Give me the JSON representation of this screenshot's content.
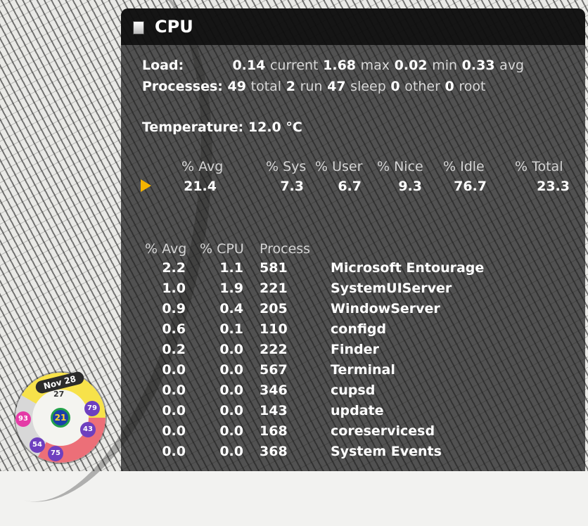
{
  "window": {
    "title": "CPU",
    "load": {
      "label": "Load:",
      "current": "0.14",
      "current_label": "current",
      "max": "1.68",
      "max_label": "max",
      "min": "0.02",
      "min_label": "min",
      "avg": "0.33",
      "avg_label": "avg"
    },
    "processes": {
      "label": "Processes:",
      "total": "49",
      "total_label": "total",
      "run": "2",
      "run_label": "run",
      "sleep": "47",
      "sleep_label": "sleep",
      "other": "0",
      "other_label": "other",
      "root": "0",
      "root_label": "root"
    },
    "temperature": {
      "label": "Temperature:",
      "value": "12.0 °C"
    },
    "summary": {
      "headers": [
        "% Avg",
        "% Sys",
        "% User",
        "% Nice",
        "% Idle",
        "% Total"
      ],
      "values": [
        "21.4",
        "7.3",
        "6.7",
        "9.3",
        "76.7",
        "23.3"
      ]
    },
    "process_table": {
      "headers": [
        "% Avg",
        "% CPU",
        "Process"
      ],
      "rows": [
        {
          "avg": "2.2",
          "cpu": "1.1",
          "pid": "581",
          "name": "Microsoft Entourage"
        },
        {
          "avg": "1.0",
          "cpu": "1.9",
          "pid": "221",
          "name": "SystemUIServer"
        },
        {
          "avg": "0.9",
          "cpu": "0.4",
          "pid": "205",
          "name": "WindowServer"
        },
        {
          "avg": "0.6",
          "cpu": "0.1",
          "pid": "110",
          "name": "configd"
        },
        {
          "avg": "0.2",
          "cpu": "0.0",
          "pid": "222",
          "name": "Finder"
        },
        {
          "avg": "0.0",
          "cpu": "0.0",
          "pid": "567",
          "name": "Terminal"
        },
        {
          "avg": "0.0",
          "cpu": "0.0",
          "pid": "346",
          "name": "cupsd"
        },
        {
          "avg": "0.0",
          "cpu": "0.0",
          "pid": "143",
          "name": "update"
        },
        {
          "avg": "0.0",
          "cpu": "0.0",
          "pid": "168",
          "name": "coreservicesd"
        },
        {
          "avg": "0.0",
          "cpu": "0.0",
          "pid": "368",
          "name": "System Events"
        }
      ]
    }
  },
  "calendar_widget": {
    "date": "Nov 28",
    "sub": "27",
    "center": "21",
    "bubbles": [
      "93",
      "79",
      "43",
      "54",
      "75"
    ]
  },
  "colors": {
    "window_bg": "#1c1c1c",
    "arrow": "#f5b400",
    "text": "#ffffff"
  },
  "icons": {
    "window": "window-icon",
    "row_marker": "play-triangle-icon"
  }
}
